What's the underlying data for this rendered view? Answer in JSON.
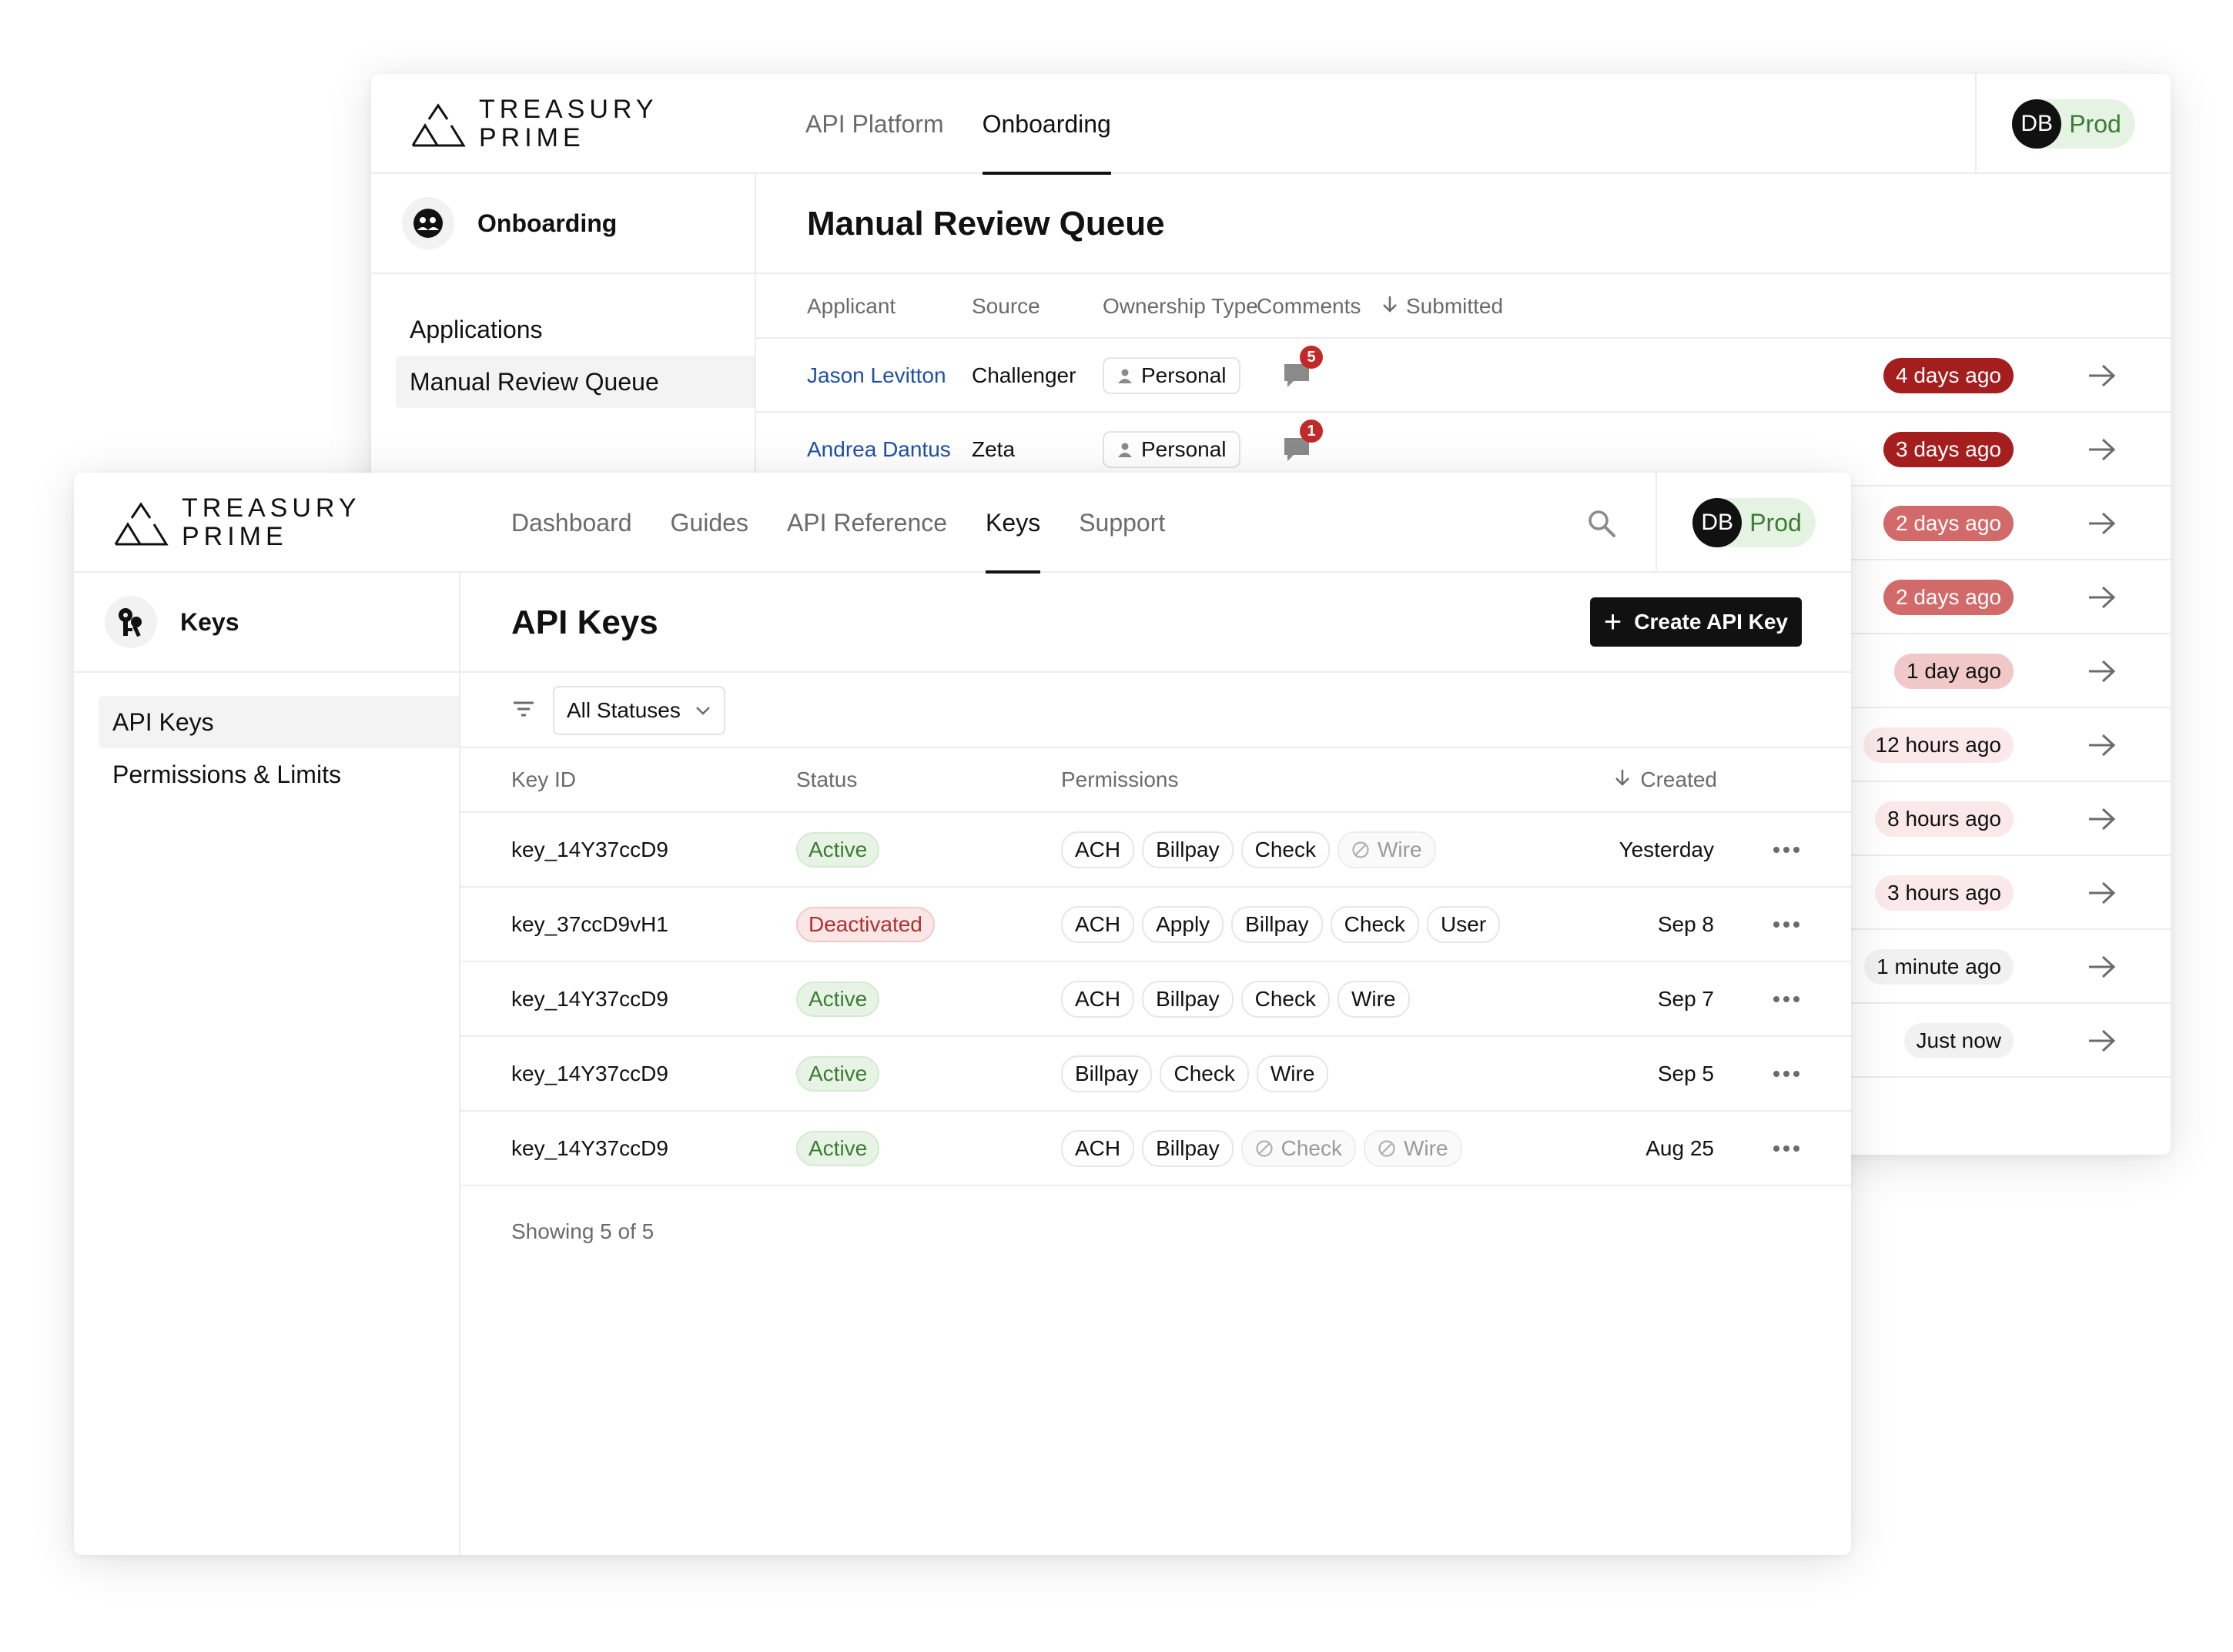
{
  "brand": {
    "line1": "TREASURY",
    "line2": "PRIME"
  },
  "back_window": {
    "nav_tabs": [
      {
        "label": "API Platform",
        "active": false
      },
      {
        "label": "Onboarding",
        "active": true
      }
    ],
    "env": {
      "initials": "DB",
      "name": "Prod"
    },
    "sidebar": {
      "title": "Onboarding",
      "items": [
        {
          "label": "Applications",
          "selected": false
        },
        {
          "label": "Manual Review Queue",
          "selected": true
        }
      ]
    },
    "page_title": "Manual Review Queue",
    "table": {
      "headers": [
        "Applicant",
        "Source",
        "Ownership Type",
        "Comments",
        "Submitted"
      ],
      "rows": [
        {
          "applicant": "Jason Levitton",
          "source": "Challenger",
          "ownership": "Personal",
          "comments": "5",
          "submitted": "4 days ago",
          "tone": "dark"
        },
        {
          "applicant": "Andrea Dantus",
          "source": "Zeta",
          "ownership": "Personal",
          "comments": "1",
          "submitted": "3 days ago",
          "tone": "dark"
        },
        {
          "applicant": "",
          "source": "",
          "ownership": "",
          "comments": "",
          "submitted": "2 days ago",
          "tone": "mid"
        },
        {
          "applicant": "",
          "source": "",
          "ownership": "",
          "comments": "",
          "submitted": "2 days ago",
          "tone": "mid"
        },
        {
          "applicant": "",
          "source": "",
          "ownership": "",
          "comments": "",
          "submitted": "1 day ago",
          "tone": "light"
        },
        {
          "applicant": "",
          "source": "",
          "ownership": "",
          "comments": "",
          "submitted": "12 hours ago",
          "tone": "pale"
        },
        {
          "applicant": "",
          "source": "",
          "ownership": "",
          "comments": "",
          "submitted": "8 hours ago",
          "tone": "pale"
        },
        {
          "applicant": "",
          "source": "",
          "ownership": "",
          "comments": "",
          "submitted": "3 hours ago",
          "tone": "pale"
        },
        {
          "applicant": "",
          "source": "",
          "ownership": "",
          "comments": "",
          "submitted": "1 minute ago",
          "tone": "gray"
        },
        {
          "applicant": "",
          "source": "",
          "ownership": "",
          "comments": "",
          "submitted": "Just now",
          "tone": "gray"
        }
      ]
    }
  },
  "front_window": {
    "nav_tabs": [
      {
        "label": "Dashboard",
        "active": false
      },
      {
        "label": "Guides",
        "active": false
      },
      {
        "label": "API Reference",
        "active": false
      },
      {
        "label": "Keys",
        "active": true
      },
      {
        "label": "Support",
        "active": false
      }
    ],
    "env": {
      "initials": "DB",
      "name": "Prod"
    },
    "sidebar": {
      "title": "Keys",
      "items": [
        {
          "label": "API Keys",
          "selected": true
        },
        {
          "label": "Permissions & Limits",
          "selected": false
        }
      ]
    },
    "page_title": "API Keys",
    "create_button": "Create API Key",
    "filter": {
      "selected": "All Statuses"
    },
    "table": {
      "headers": [
        "Key ID",
        "Status",
        "Permissions",
        "Created"
      ],
      "rows": [
        {
          "key_id": "key_14Y37ccD9",
          "status": "Active",
          "status_type": "active",
          "permissions": [
            {
              "label": "ACH",
              "on": true
            },
            {
              "label": "Billpay",
              "on": true
            },
            {
              "label": "Check",
              "on": true
            },
            {
              "label": "Wire",
              "on": false
            }
          ],
          "created": "Yesterday"
        },
        {
          "key_id": "key_37ccD9vH1",
          "status": "Deactivated",
          "status_type": "deact",
          "permissions": [
            {
              "label": "ACH",
              "on": true
            },
            {
              "label": "Apply",
              "on": true
            },
            {
              "label": "Billpay",
              "on": true
            },
            {
              "label": "Check",
              "on": true
            },
            {
              "label": "User",
              "on": true
            }
          ],
          "created": "Sep 8"
        },
        {
          "key_id": "key_14Y37ccD9",
          "status": "Active",
          "status_type": "active",
          "permissions": [
            {
              "label": "ACH",
              "on": true
            },
            {
              "label": "Billpay",
              "on": true
            },
            {
              "label": "Check",
              "on": true
            },
            {
              "label": "Wire",
              "on": true
            }
          ],
          "created": "Sep 7"
        },
        {
          "key_id": "key_14Y37ccD9",
          "status": "Active",
          "status_type": "active",
          "permissions": [
            {
              "label": "Billpay",
              "on": true
            },
            {
              "label": "Check",
              "on": true
            },
            {
              "label": "Wire",
              "on": true
            }
          ],
          "created": "Sep 5"
        },
        {
          "key_id": "key_14Y37ccD9",
          "status": "Active",
          "status_type": "active",
          "permissions": [
            {
              "label": "ACH",
              "on": true
            },
            {
              "label": "Billpay",
              "on": true
            },
            {
              "label": "Check",
              "on": false
            },
            {
              "label": "Wire",
              "on": false
            }
          ],
          "created": "Aug 25"
        }
      ]
    },
    "footer_text": "Showing 5 of 5"
  },
  "colors": {
    "tone_dark": "#a51e1e",
    "tone_mid": "#d26a6a",
    "tone_light": "#f1c8c8",
    "tone_pale": "#fbe9e9",
    "tone_gray": "#f1f1f1",
    "link": "#1f4fa6",
    "active_green": "#3d7a34",
    "deactivated_red": "#b0302f"
  }
}
